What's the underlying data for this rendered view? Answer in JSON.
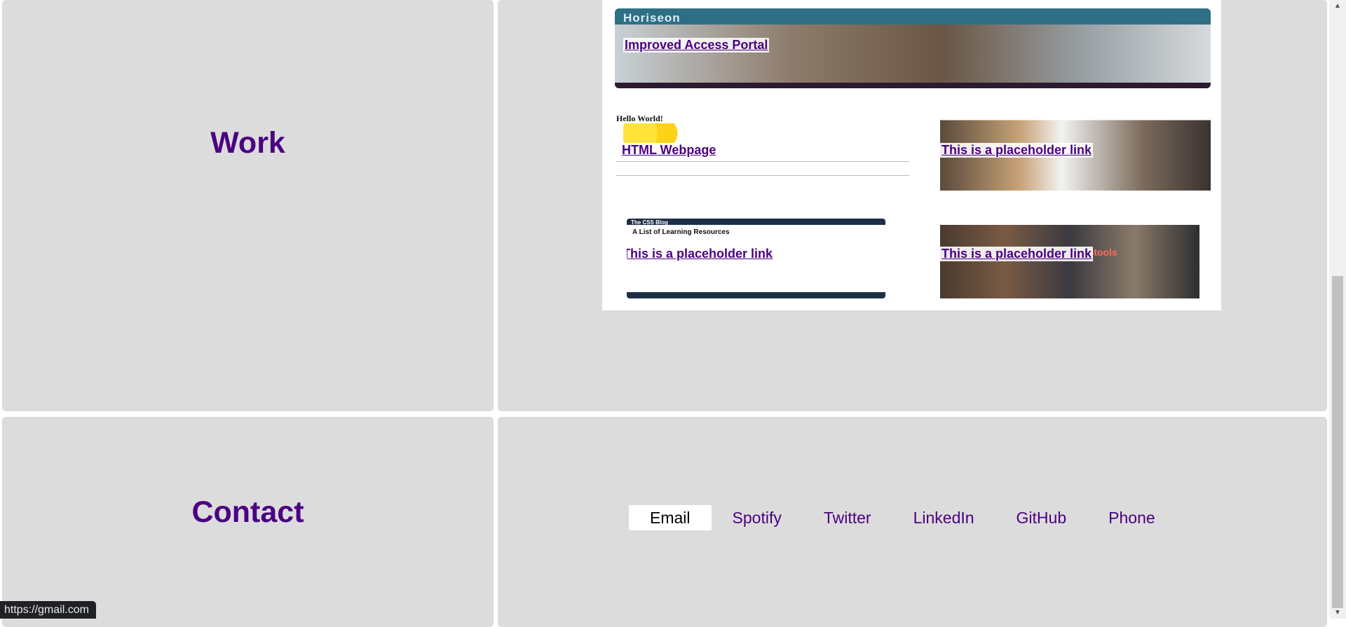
{
  "work": {
    "title": "Work",
    "projects": [
      {
        "link": "Improved Access Portal",
        "brand": "Horiseon"
      },
      {
        "link": "HTML Webpage",
        "heading": "Hello World!"
      },
      {
        "link": "This is a placeholder link"
      },
      {
        "link": "This is a placeholder link",
        "blog_title": "The CSS Blog",
        "blog_heading": "A List of Learning Resources"
      },
      {
        "link": "This is a placeholder link",
        "overlay_text": "Stools"
      }
    ]
  },
  "contact": {
    "title": "Contact",
    "links": [
      "Email",
      "Spotify",
      "Twitter",
      "LinkedIn",
      "GitHub",
      "Phone"
    ],
    "active": "Email"
  },
  "status_bar": {
    "url": "https://gmail.com"
  },
  "colors": {
    "accent": "#4b0082",
    "panel": "#dcdcdc",
    "status_bg": "#202124"
  },
  "scrollbar": {
    "up_icon": "▲",
    "down_icon": "▼"
  }
}
